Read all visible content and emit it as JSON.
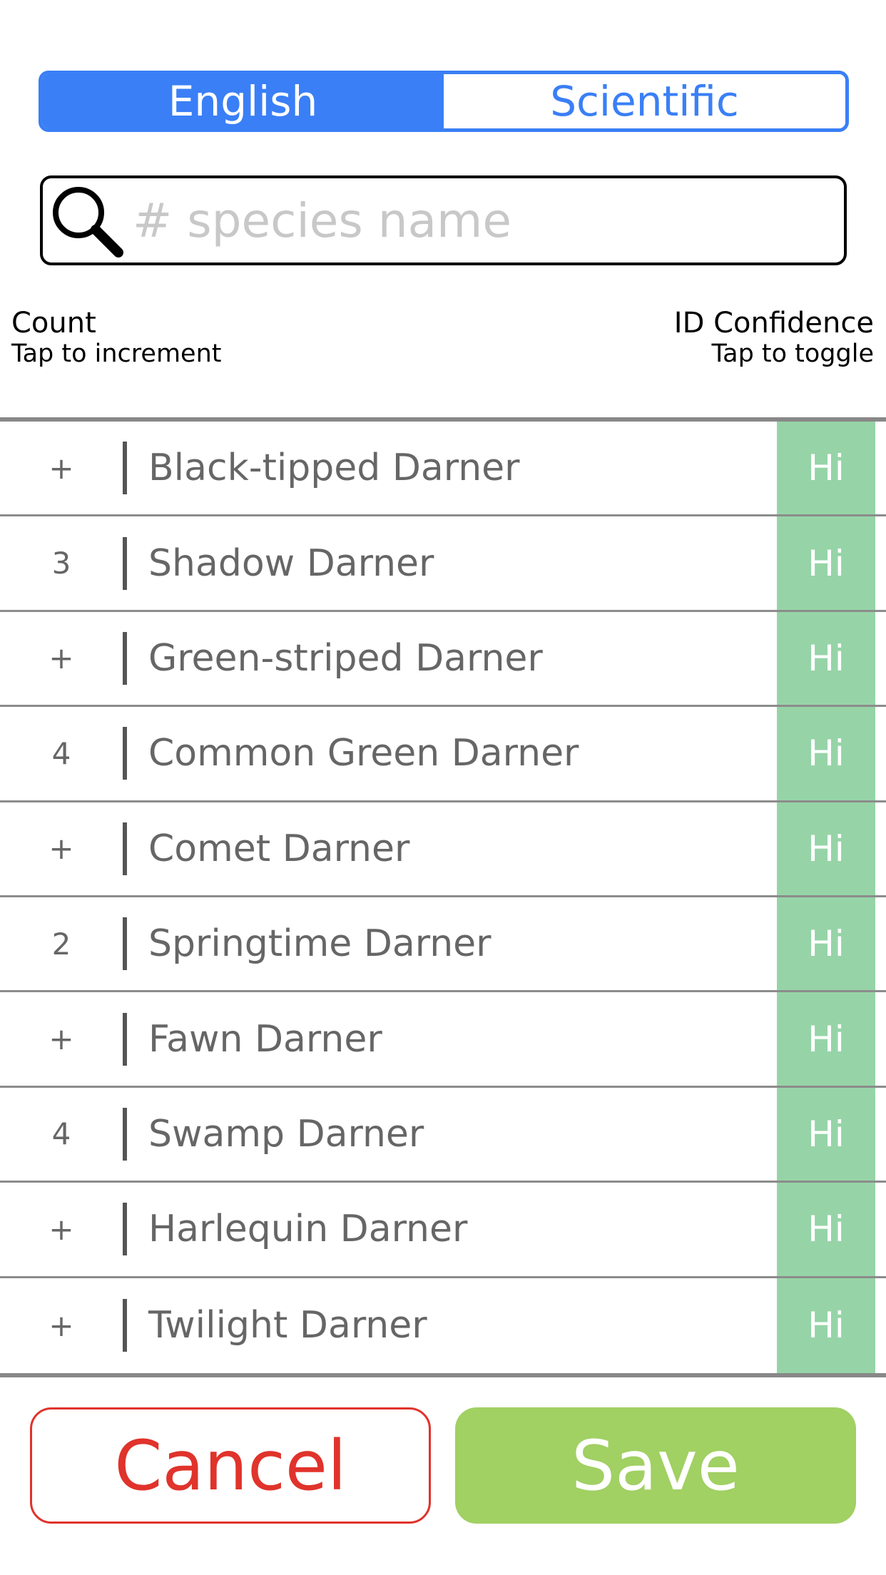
{
  "toggle": {
    "options": [
      "English",
      "Scientific"
    ],
    "selected": "English"
  },
  "search": {
    "placeholder": "# species name",
    "value": "",
    "icon": "search-icon"
  },
  "header": {
    "left_title": "Count",
    "left_sub": "Tap to increment",
    "right_title": "ID Confidence",
    "right_sub": "Tap to toggle"
  },
  "species": [
    {
      "count": "+",
      "name": "Black-tipped Darner",
      "confidence": "Hi"
    },
    {
      "count": "3",
      "name": "Shadow Darner",
      "confidence": "Hi"
    },
    {
      "count": "+",
      "name": "Green-striped Darner",
      "confidence": "Hi"
    },
    {
      "count": "4",
      "name": "Common Green Darner",
      "confidence": "Hi"
    },
    {
      "count": "+",
      "name": "Comet Darner",
      "confidence": "Hi"
    },
    {
      "count": "2",
      "name": "Springtime Darner",
      "confidence": "Hi"
    },
    {
      "count": "+",
      "name": "Fawn Darner",
      "confidence": "Hi"
    },
    {
      "count": "4",
      "name": "Swamp Darner",
      "confidence": "Hi"
    },
    {
      "count": "+",
      "name": "Harlequin Darner",
      "confidence": "Hi"
    },
    {
      "count": "+",
      "name": "Twilight Darner",
      "confidence": "Hi"
    }
  ],
  "buttons": {
    "cancel": "Cancel",
    "save": "Save"
  },
  "colors": {
    "accent": "#3a7ff6",
    "confidence_hi": "#96d4a7",
    "cancel": "#e0332b",
    "save": "#a1d063"
  }
}
